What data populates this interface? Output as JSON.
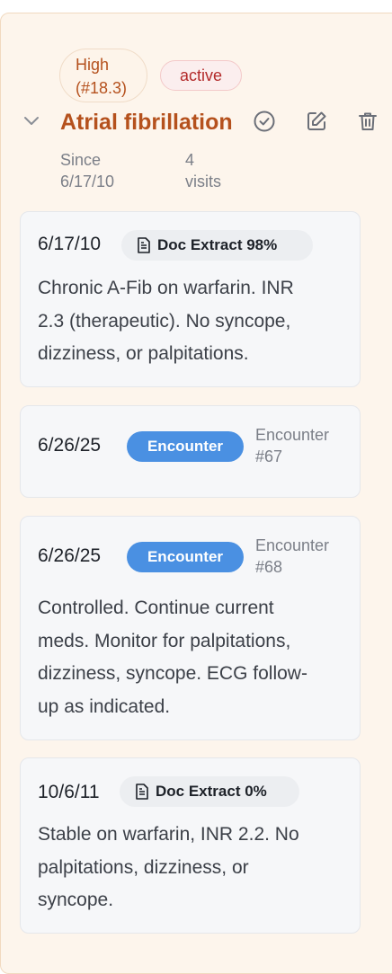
{
  "problem": {
    "priority_line1": "High",
    "priority_line2": "(#18.3)",
    "status": "active",
    "title": "Atrial fibrillation",
    "since_label": "Since",
    "since_date": "6/17/10",
    "visits_count": "4",
    "visits_label": "visits"
  },
  "icons": {
    "collapse": "chevron-down-icon",
    "resolve": "check-circle-icon",
    "edit": "edit-icon",
    "delete": "trash-icon",
    "doc": "document-icon"
  },
  "colors": {
    "accent": "#b5511d",
    "encounter_badge": "#4a90e2",
    "status_text": "#b32a2a",
    "panel_background": "#fdf5ec"
  },
  "entries": [
    {
      "date": "6/17/10",
      "badge": "Doc Extract 98%",
      "note_lines": [
        "Chronic A-Fib on warfarin. INR",
        "2.3 (therapeutic). No syncope,",
        "dizziness, or palpitations."
      ]
    },
    {
      "date": "6/26/25",
      "badge": "Encounter",
      "ref_line1": "Encounter",
      "ref_line2": "#67"
    },
    {
      "date": "6/26/25",
      "badge": "Encounter",
      "ref_line1": "Encounter",
      "ref_line2": "#68",
      "note_lines": [
        "Controlled. Continue current",
        "meds. Monitor for palpitations,",
        "dizziness, syncope. ECG follow-",
        "up as indicated."
      ]
    },
    {
      "date": "10/6/11",
      "badge": "Doc Extract 0%",
      "note_lines": [
        "Stable on warfarin, INR 2.2. No",
        "palpitations, dizziness, or",
        "syncope."
      ]
    }
  ]
}
